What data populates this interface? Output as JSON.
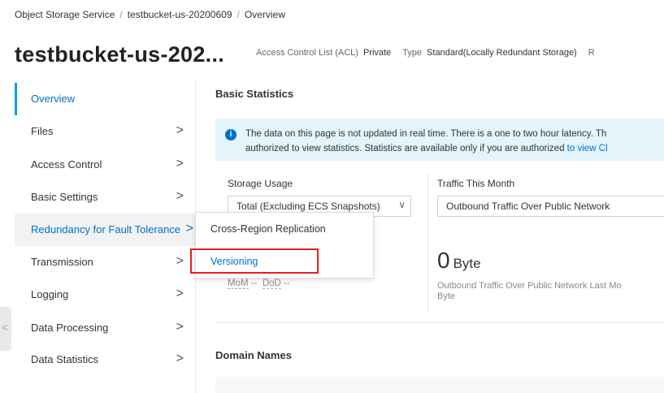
{
  "breadcrumb": {
    "items": [
      "Object Storage Service",
      "testbucket-us-20200609",
      "Overview"
    ],
    "separator": "/"
  },
  "header": {
    "bucket_title": "testbucket-us-202...",
    "acl_label": "Access Control List (ACL)",
    "acl_value": "Private",
    "type_label": "Type",
    "type_value": "Standard(Locally Redundant Storage)",
    "trailing": "R"
  },
  "sidebar": {
    "items": [
      {
        "label": "Overview",
        "chevron": ""
      },
      {
        "label": "Files",
        "chevron": ">"
      },
      {
        "label": "Access Control",
        "chevron": ">"
      },
      {
        "label": "Basic Settings",
        "chevron": ">"
      },
      {
        "label": "Redundancy for Fault Tolerance",
        "chevron": ">"
      },
      {
        "label": "Transmission",
        "chevron": ">"
      },
      {
        "label": "Logging",
        "chevron": ">"
      },
      {
        "label": "Data Processing",
        "chevron": ">"
      },
      {
        "label": "Data Statistics",
        "chevron": ">"
      }
    ],
    "collapse_glyph": "<"
  },
  "dropdown": {
    "items": [
      "Cross-Region Replication",
      "Versioning"
    ]
  },
  "main": {
    "basic_statistics_title": "Basic Statistics",
    "info_icon": "i",
    "info_line1": "The data on this page is not updated in real time. There is a one to two hour latency. Th",
    "info_line2_prefix": "authorized to view statistics. Statistics are available only if you are authorized ",
    "info_link": "to view Cl",
    "storage_usage_label": "Storage Usage",
    "storage_select_value": "Total (Excluding ECS Snapshots)",
    "storage_select_arrow": "∨",
    "traffic_label": "Traffic This Month",
    "traffic_select_value": "Outbound Traffic Over Public Network",
    "traffic_value": "0",
    "traffic_unit": "Byte",
    "mom_label": "MoM",
    "mom_value": "--",
    "dod_label": "DoD",
    "dod_value": "--",
    "traffic_note_line1": "Outbound Traffic Over Public Network Last Mo",
    "traffic_note_line2": "Byte",
    "domain_names_title": "Domain Names"
  },
  "colors": {
    "accent": "#0070cc",
    "active_bar": "#00a3e0",
    "info_bg": "#e4f4fb",
    "highlight_box": "#e02020"
  }
}
